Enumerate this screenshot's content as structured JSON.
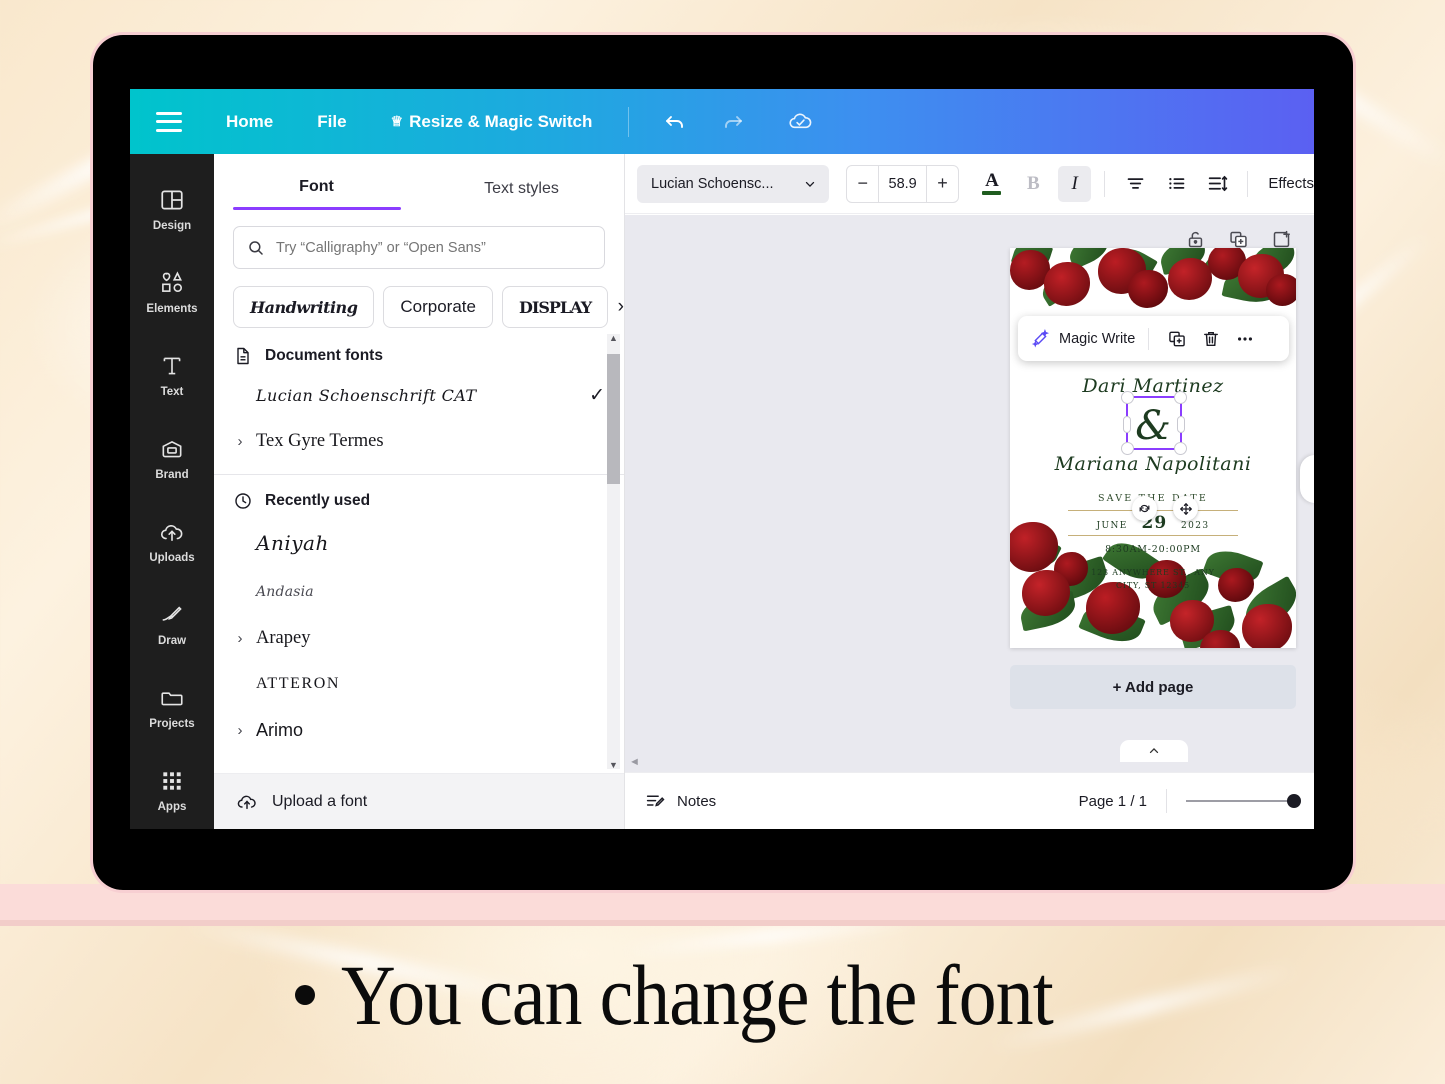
{
  "background": {
    "style": "cream-marble-texture",
    "accent_pink": "#fbdcd9"
  },
  "header": {
    "menu_icon": "hamburger-icon",
    "items": [
      {
        "label": "Home"
      },
      {
        "label": "File"
      },
      {
        "label": "Resize & Magic Switch",
        "icon": "crown-icon"
      }
    ],
    "actions": [
      {
        "icon": "undo-icon"
      },
      {
        "icon": "redo-icon"
      },
      {
        "icon": "cloud-saved-icon"
      }
    ],
    "gradient_start": "#00c4cc",
    "gradient_end": "#5b60f2"
  },
  "sidebar": {
    "items": [
      {
        "label": "Design",
        "icon": "layout-icon"
      },
      {
        "label": "Elements",
        "icon": "shapes-icon"
      },
      {
        "label": "Text",
        "icon": "text-t-icon"
      },
      {
        "label": "Brand",
        "icon": "brand-kit-icon"
      },
      {
        "label": "Uploads",
        "icon": "cloud-upload-icon"
      },
      {
        "label": "Draw",
        "icon": "pen-draw-icon"
      },
      {
        "label": "Projects",
        "icon": "folder-icon"
      },
      {
        "label": "Apps",
        "icon": "grid-apps-icon"
      }
    ]
  },
  "font_panel": {
    "tabs": [
      {
        "label": "Font",
        "active": true
      },
      {
        "label": "Text styles",
        "active": false
      }
    ],
    "search": {
      "placeholder": "Try “Calligraphy” or “Open Sans”",
      "value": "",
      "icon": "search-icon"
    },
    "chips": [
      {
        "label": "Handwriting"
      },
      {
        "label": "Corporate"
      },
      {
        "label": "DISPLAY"
      }
    ],
    "chip_next": "›",
    "sections": [
      {
        "title": "Document fonts",
        "icon": "document-icon",
        "fonts": [
          {
            "name": "Lucian Schoenschrift CAT",
            "style": "script",
            "selected": true,
            "expandable": false
          },
          {
            "name": "Tex Gyre Termes",
            "style": "serif",
            "selected": false,
            "expandable": true
          }
        ]
      },
      {
        "title": "Recently used",
        "icon": "clock-icon",
        "fonts": [
          {
            "name": "Aniyah",
            "style": "script-large",
            "selected": false,
            "expandable": false
          },
          {
            "name": "Andasia",
            "style": "script-small",
            "selected": false,
            "expandable": false
          },
          {
            "name": "Arapey",
            "style": "serif",
            "selected": false,
            "expandable": true
          },
          {
            "name": "ATTERON",
            "style": "display",
            "selected": false,
            "expandable": false
          },
          {
            "name": "Arimo",
            "style": "sans",
            "selected": false,
            "expandable": true
          }
        ]
      }
    ],
    "upload": {
      "label": "Upload a font",
      "icon": "cloud-upload-icon"
    }
  },
  "toolbar": {
    "font_name": "Lucian Schoensc...",
    "font_caret": "chevron-down-icon",
    "decrease": "−",
    "font_size": "58.9",
    "increase": "+",
    "buttons": [
      {
        "name": "text-color",
        "label": "A",
        "active": false
      },
      {
        "name": "bold",
        "label": "B",
        "active": false,
        "disabled": true
      },
      {
        "name": "italic",
        "label": "I",
        "active": true
      },
      {
        "name": "align",
        "label": "align-icon",
        "active": false
      },
      {
        "name": "list",
        "label": "list-icon",
        "active": false
      },
      {
        "name": "spacing",
        "label": "line-spacing-icon",
        "active": false
      }
    ],
    "effects_label": "Effects",
    "text_color": "#1f5c1f"
  },
  "canvas": {
    "object_tools": [
      {
        "icon": "lock-icon"
      },
      {
        "icon": "duplicate-icon"
      },
      {
        "icon": "position-icon"
      }
    ],
    "context_toolbar": {
      "magic_write": {
        "label": "Magic Write",
        "icon": "magic-pen-icon"
      },
      "duplicate_icon": "duplicate-icon",
      "delete_icon": "trash-icon",
      "more_icon": "more-dots-icon"
    },
    "selection": {
      "rotate_icon": "rotate-icon",
      "move_icon": "move-icon",
      "border_color": "#8b3dff"
    },
    "add_page_label": "+ Add page",
    "collapse_icon": "chevron-up-icon"
  },
  "invitation": {
    "name_top": "Dari Martinez",
    "ampersand": "&",
    "name_bottom": "Mariana Napolitani",
    "save_the_date": "SAVE THE DATE",
    "date_prefix": "JUNE",
    "date_number": "29",
    "date_suffix": "2023",
    "time": "8:30AM-20:00PM",
    "address_line1": "123 ANYWHERE ST., ANY",
    "address_line2": "CITY, ST 12345",
    "text_color": "#1d3b20",
    "accent_color": "#c6b07a"
  },
  "status_bar": {
    "notes_label": "Notes",
    "notes_icon": "notes-icon",
    "page_label": "Page 1 / 1",
    "zoom_slider": {
      "value": 100
    }
  },
  "caption": {
    "bullet": "•",
    "text": "You can change the font"
  }
}
